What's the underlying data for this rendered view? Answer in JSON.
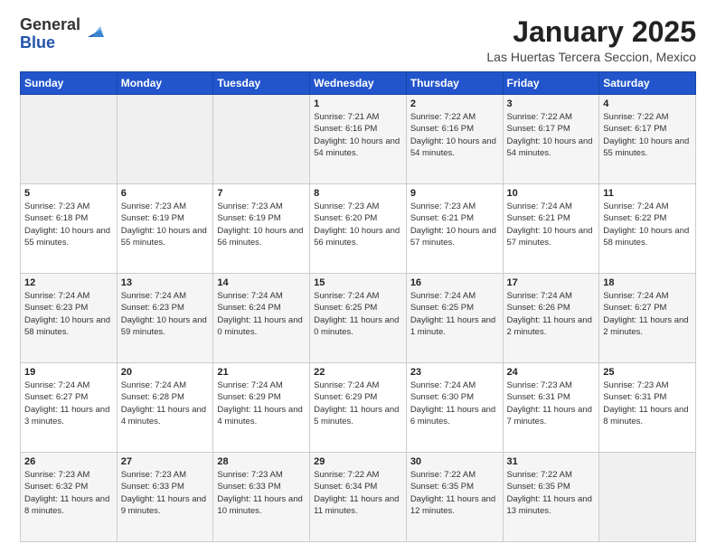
{
  "logo": {
    "general": "General",
    "blue": "Blue"
  },
  "header": {
    "month": "January 2025",
    "location": "Las Huertas Tercera Seccion, Mexico"
  },
  "weekdays": [
    "Sunday",
    "Monday",
    "Tuesday",
    "Wednesday",
    "Thursday",
    "Friday",
    "Saturday"
  ],
  "weeks": [
    [
      {
        "day": "",
        "info": ""
      },
      {
        "day": "",
        "info": ""
      },
      {
        "day": "",
        "info": ""
      },
      {
        "day": "1",
        "info": "Sunrise: 7:21 AM\nSunset: 6:16 PM\nDaylight: 10 hours and 54 minutes."
      },
      {
        "day": "2",
        "info": "Sunrise: 7:22 AM\nSunset: 6:16 PM\nDaylight: 10 hours and 54 minutes."
      },
      {
        "day": "3",
        "info": "Sunrise: 7:22 AM\nSunset: 6:17 PM\nDaylight: 10 hours and 54 minutes."
      },
      {
        "day": "4",
        "info": "Sunrise: 7:22 AM\nSunset: 6:17 PM\nDaylight: 10 hours and 55 minutes."
      }
    ],
    [
      {
        "day": "5",
        "info": "Sunrise: 7:23 AM\nSunset: 6:18 PM\nDaylight: 10 hours and 55 minutes."
      },
      {
        "day": "6",
        "info": "Sunrise: 7:23 AM\nSunset: 6:19 PM\nDaylight: 10 hours and 55 minutes."
      },
      {
        "day": "7",
        "info": "Sunrise: 7:23 AM\nSunset: 6:19 PM\nDaylight: 10 hours and 56 minutes."
      },
      {
        "day": "8",
        "info": "Sunrise: 7:23 AM\nSunset: 6:20 PM\nDaylight: 10 hours and 56 minutes."
      },
      {
        "day": "9",
        "info": "Sunrise: 7:23 AM\nSunset: 6:21 PM\nDaylight: 10 hours and 57 minutes."
      },
      {
        "day": "10",
        "info": "Sunrise: 7:24 AM\nSunset: 6:21 PM\nDaylight: 10 hours and 57 minutes."
      },
      {
        "day": "11",
        "info": "Sunrise: 7:24 AM\nSunset: 6:22 PM\nDaylight: 10 hours and 58 minutes."
      }
    ],
    [
      {
        "day": "12",
        "info": "Sunrise: 7:24 AM\nSunset: 6:23 PM\nDaylight: 10 hours and 58 minutes."
      },
      {
        "day": "13",
        "info": "Sunrise: 7:24 AM\nSunset: 6:23 PM\nDaylight: 10 hours and 59 minutes."
      },
      {
        "day": "14",
        "info": "Sunrise: 7:24 AM\nSunset: 6:24 PM\nDaylight: 11 hours and 0 minutes."
      },
      {
        "day": "15",
        "info": "Sunrise: 7:24 AM\nSunset: 6:25 PM\nDaylight: 11 hours and 0 minutes."
      },
      {
        "day": "16",
        "info": "Sunrise: 7:24 AM\nSunset: 6:25 PM\nDaylight: 11 hours and 1 minute."
      },
      {
        "day": "17",
        "info": "Sunrise: 7:24 AM\nSunset: 6:26 PM\nDaylight: 11 hours and 2 minutes."
      },
      {
        "day": "18",
        "info": "Sunrise: 7:24 AM\nSunset: 6:27 PM\nDaylight: 11 hours and 2 minutes."
      }
    ],
    [
      {
        "day": "19",
        "info": "Sunrise: 7:24 AM\nSunset: 6:27 PM\nDaylight: 11 hours and 3 minutes."
      },
      {
        "day": "20",
        "info": "Sunrise: 7:24 AM\nSunset: 6:28 PM\nDaylight: 11 hours and 4 minutes."
      },
      {
        "day": "21",
        "info": "Sunrise: 7:24 AM\nSunset: 6:29 PM\nDaylight: 11 hours and 4 minutes."
      },
      {
        "day": "22",
        "info": "Sunrise: 7:24 AM\nSunset: 6:29 PM\nDaylight: 11 hours and 5 minutes."
      },
      {
        "day": "23",
        "info": "Sunrise: 7:24 AM\nSunset: 6:30 PM\nDaylight: 11 hours and 6 minutes."
      },
      {
        "day": "24",
        "info": "Sunrise: 7:23 AM\nSunset: 6:31 PM\nDaylight: 11 hours and 7 minutes."
      },
      {
        "day": "25",
        "info": "Sunrise: 7:23 AM\nSunset: 6:31 PM\nDaylight: 11 hours and 8 minutes."
      }
    ],
    [
      {
        "day": "26",
        "info": "Sunrise: 7:23 AM\nSunset: 6:32 PM\nDaylight: 11 hours and 8 minutes."
      },
      {
        "day": "27",
        "info": "Sunrise: 7:23 AM\nSunset: 6:33 PM\nDaylight: 11 hours and 9 minutes."
      },
      {
        "day": "28",
        "info": "Sunrise: 7:23 AM\nSunset: 6:33 PM\nDaylight: 11 hours and 10 minutes."
      },
      {
        "day": "29",
        "info": "Sunrise: 7:22 AM\nSunset: 6:34 PM\nDaylight: 11 hours and 11 minutes."
      },
      {
        "day": "30",
        "info": "Sunrise: 7:22 AM\nSunset: 6:35 PM\nDaylight: 11 hours and 12 minutes."
      },
      {
        "day": "31",
        "info": "Sunrise: 7:22 AM\nSunset: 6:35 PM\nDaylight: 11 hours and 13 minutes."
      },
      {
        "day": "",
        "info": ""
      }
    ]
  ]
}
